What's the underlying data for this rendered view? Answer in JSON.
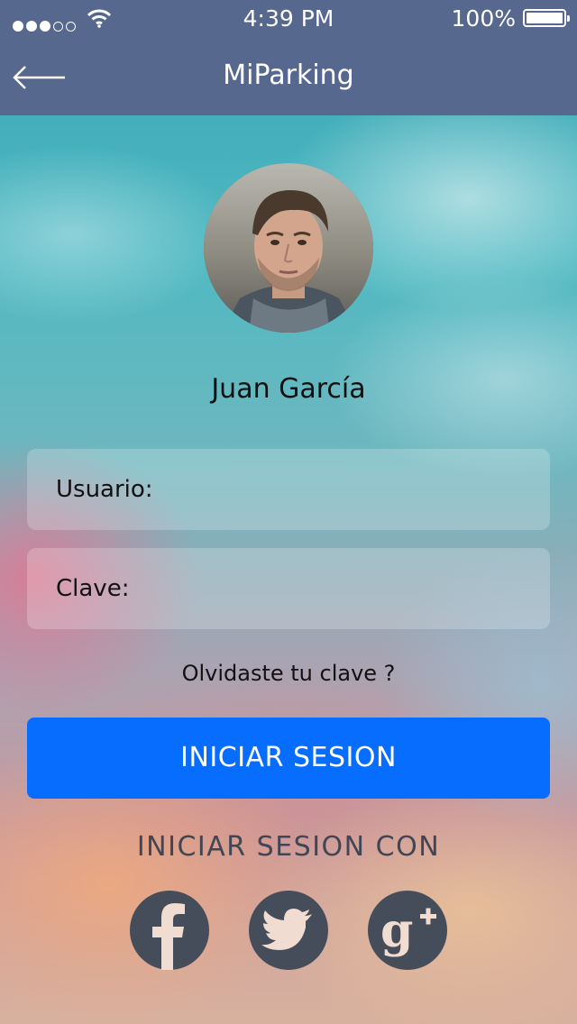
{
  "status_bar": {
    "signal_bars_filled": 3,
    "signal_bars_total": 5,
    "time": "4:39 PM",
    "battery": "100%",
    "battery_level": 1.0
  },
  "nav": {
    "title": "MiParking",
    "back_icon": "back-arrow-icon"
  },
  "profile": {
    "name": "Juan García"
  },
  "form": {
    "username_label": "Usuario:",
    "username_value": "",
    "password_label": "Clave:",
    "password_value": "",
    "forgot_link": "Olvidaste tu clave ?",
    "login_button": "INICIAR SESION"
  },
  "social": {
    "heading": "INICIAR SESION CON",
    "providers": [
      "facebook-icon",
      "twitter-icon",
      "google-plus-icon"
    ]
  },
  "colors": {
    "nav_bg": "#56688e",
    "primary_button": "#066dff",
    "social_icon_bg": "#454d5a"
  }
}
